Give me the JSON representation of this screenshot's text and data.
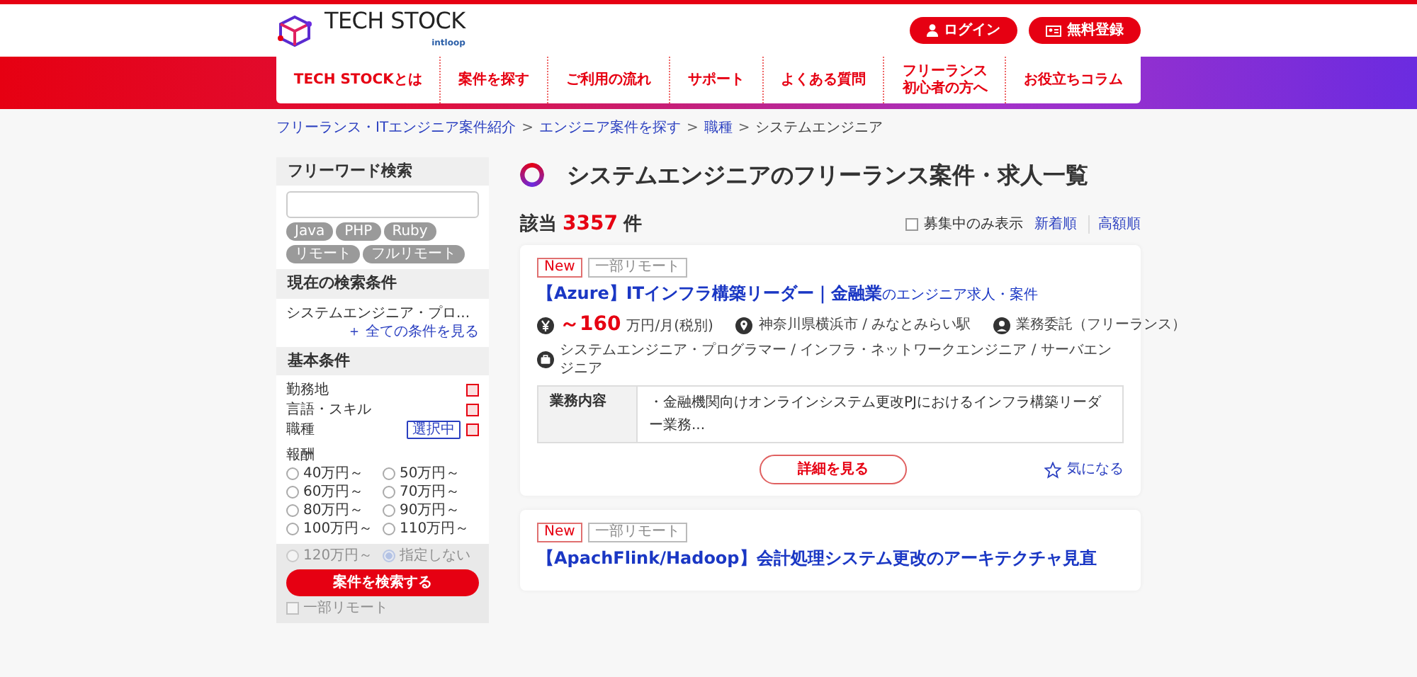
{
  "header": {
    "logo": "TECH STOCK",
    "logo_by": "intloop",
    "buttons": [
      {
        "label": "ログイン",
        "kind": "login"
      },
      {
        "label": "無料登録",
        "kind": "register"
      }
    ]
  },
  "nav": [
    {
      "lines": [
        "TECH STOCKとは"
      ]
    },
    {
      "lines": [
        "案件を探す"
      ]
    },
    {
      "lines": [
        "ご利用の流れ"
      ]
    },
    {
      "lines": [
        "サポート"
      ]
    },
    {
      "lines": [
        "よくある質問"
      ]
    },
    {
      "lines": [
        "フリーランス",
        "初心者の方へ"
      ]
    },
    {
      "lines": [
        "お役立ちコラム"
      ]
    }
  ],
  "breadcrumb": [
    {
      "label": "フリーランス・ITエンジニア案件紹介",
      "kind": "link"
    },
    {
      "separator": ">",
      "label": "エンジニア案件を探す",
      "kind": "link"
    },
    {
      "separator": ">",
      "label": "職種",
      "kind": "link"
    },
    {
      "separator": ">",
      "label": "システムエンジニア",
      "kind": "current"
    }
  ],
  "sidebar": {
    "free_word": {
      "heading": "フリーワード検索",
      "tags": [
        "Java",
        "PHP",
        "Ruby",
        "リモート",
        "フルリモート"
      ]
    },
    "current": {
      "heading": "現在の検索条件",
      "text": "システムエンジニア・プロ...",
      "link": "＋ 全ての条件を見る"
    },
    "basic": {
      "heading": "基本条件",
      "items": [
        {
          "label": "勤務地",
          "selected": false
        },
        {
          "label": "言語・スキル",
          "selected": false
        },
        {
          "label": "職種",
          "selected": true
        }
      ],
      "selected_badge": "選択中"
    },
    "pay": {
      "label": "報酬",
      "options": [
        {
          "label": "40万円～",
          "selected": false
        },
        {
          "label": "50万円～",
          "selected": false
        },
        {
          "label": "60万円～",
          "selected": false
        },
        {
          "label": "70万円～",
          "selected": false
        },
        {
          "label": "80万円～",
          "selected": false
        },
        {
          "label": "90万円～",
          "selected": false
        },
        {
          "label": "100万円～",
          "selected": false
        },
        {
          "label": "110万円～",
          "selected": false
        },
        {
          "label": "120万円～",
          "selected": false
        },
        {
          "label": "指定しない",
          "selected": true
        }
      ]
    },
    "search_button": "案件を検索する",
    "remote_checkbox": {
      "label": "一部リモート",
      "checked": false
    }
  },
  "main": {
    "title": "システムエンジニアのフリーランス案件・求人一覧",
    "count_prefix": "該当",
    "count": "3357",
    "count_suffix": "件",
    "open_only": {
      "label": "募集中のみ表示",
      "checked": false
    },
    "sorts": [
      "新着順",
      "高額順"
    ],
    "jobs": [
      {
        "tags": [
          {
            "label": "New",
            "kind": "new"
          },
          {
            "label": "一部リモート",
            "kind": "remote"
          }
        ],
        "title": "【Azure】ITインフラ構築リーダー｜金融業",
        "title_suffix": "のエンジニア求人・案件",
        "salary": "～160",
        "salary_unit": "万円/月(税別)",
        "location": "神奈川県横浜市 / みなとみらい駅",
        "contract": "業務委託（フリーランス）",
        "job_types": "システムエンジニア・プログラマー / インフラ・ネットワークエンジニア / サーバエンジニア",
        "detail_label": "業務内容",
        "detail": "・金融機関向けオンラインシステム更改PJにおけるインフラ構築リーダー業務...",
        "button": "詳細を見る",
        "favorite": "気になる"
      },
      {
        "tags": [
          {
            "label": "New",
            "kind": "new"
          },
          {
            "label": "一部リモート",
            "kind": "remote"
          }
        ],
        "title": "【ApachFlink/Hadoop】会計処理システム更改のアーキテクチャ見直"
      }
    ]
  }
}
